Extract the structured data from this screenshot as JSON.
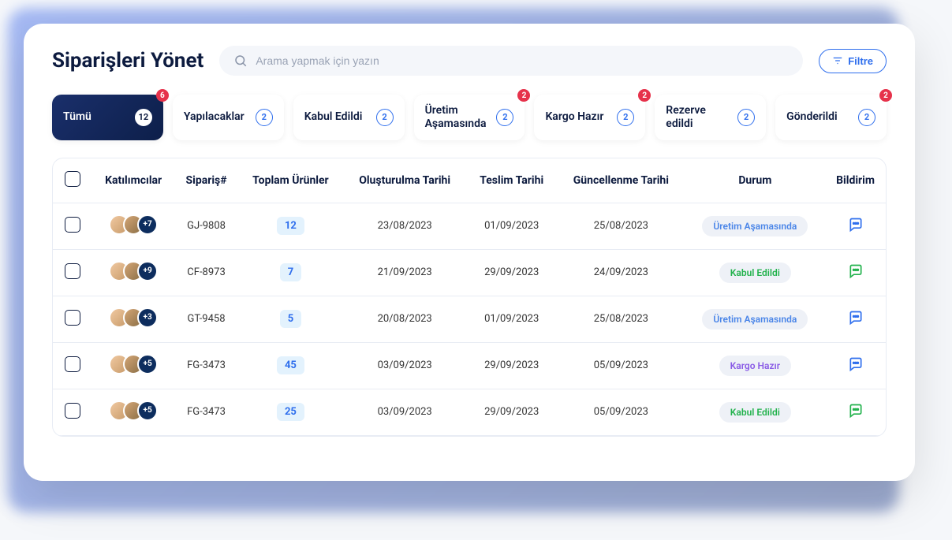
{
  "header": {
    "title": "Siparişleri Yönet",
    "search_placeholder": "Arama yapmak için yazın",
    "filter_label": "Filtre"
  },
  "tabs": [
    {
      "label": "Tümü",
      "count": "12",
      "badge": "6",
      "active": true
    },
    {
      "label": "Yapılacaklar",
      "count": "2",
      "badge": null,
      "active": false
    },
    {
      "label": "Kabul Edildi",
      "count": "2",
      "badge": null,
      "active": false
    },
    {
      "label": "Üretim Aşamasında",
      "count": "2",
      "badge": "2",
      "active": false
    },
    {
      "label": "Kargo Hazır",
      "count": "2",
      "badge": "2",
      "active": false
    },
    {
      "label": "Rezerve edildi",
      "count": "2",
      "badge": null,
      "active": false
    },
    {
      "label": "Gönderildi",
      "count": "2",
      "badge": "2",
      "active": false
    }
  ],
  "columns": {
    "participants": "Katılımcılar",
    "order_no": "Sipariş#",
    "total_products": "Toplam Ürünler",
    "created_date": "Oluşturulma Tarihi",
    "delivery_date": "Teslim Tarihi",
    "updated_date": "Güncellenme Tarihi",
    "status": "Durum",
    "notif": "Bildirim"
  },
  "rows": [
    {
      "more": "+7",
      "order": "GJ-9808",
      "qty": "12",
      "created": "23/08/2023",
      "delivery": "01/09/2023",
      "updated": "25/08/2023",
      "status": "Üretim Aşamasında",
      "status_class": "status-uretim",
      "notif_color": "#2e6eed"
    },
    {
      "more": "+9",
      "order": "CF-8973",
      "qty": "7",
      "created": "21/09/2023",
      "delivery": "29/09/2023",
      "updated": "24/09/2023",
      "status": "Kabul Edildi",
      "status_class": "status-kabul",
      "notif_color": "#22b24c"
    },
    {
      "more": "+3",
      "order": "GT-9458",
      "qty": "5",
      "created": "20/08/2023",
      "delivery": "01/09/2023",
      "updated": "25/08/2023",
      "status": "Üretim Aşamasında",
      "status_class": "status-uretim",
      "notif_color": "#2e6eed"
    },
    {
      "more": "+5",
      "order": "FG-3473",
      "qty": "45",
      "created": "03/09/2023",
      "delivery": "29/09/2023",
      "updated": "05/09/2023",
      "status": "Kargo Hazır",
      "status_class": "status-kargo",
      "notif_color": "#2e6eed"
    },
    {
      "more": "+5",
      "order": "FG-3473",
      "qty": "25",
      "created": "03/09/2023",
      "delivery": "29/09/2023",
      "updated": "05/09/2023",
      "status": "Kabul Edildi",
      "status_class": "status-kabul",
      "notif_color": "#22b24c"
    }
  ]
}
